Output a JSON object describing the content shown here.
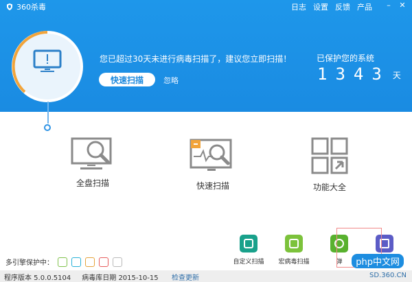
{
  "window": {
    "title": "360杀毒",
    "menu": [
      "日志",
      "设置",
      "反馈",
      "产品"
    ]
  },
  "status": {
    "warning": "您已超过30天未进行病毒扫描了，建议您立即扫描！",
    "quick_scan_button": "快速扫描",
    "ignore_label": "忽略",
    "protected_label": "已保护您的系统",
    "protected_days_digits": [
      "1",
      "3",
      "4",
      "3"
    ],
    "days_unit": "天"
  },
  "features": [
    {
      "label": "全盘扫描",
      "icon": "full-scan-icon"
    },
    {
      "label": "快速扫描",
      "icon": "quick-scan-icon"
    },
    {
      "label": "功能大全",
      "icon": "tools-grid-icon"
    }
  ],
  "bottom": {
    "engines_label": "多引擎保护中：",
    "tools": [
      {
        "label": "自定义扫描",
        "icon": "custom-scan-icon"
      },
      {
        "label": "宏病毒扫描",
        "icon": "macro-scan-icon"
      },
      {
        "label": "弹",
        "icon": "popup-block-icon"
      },
      {
        "label": "",
        "icon": "layers-icon"
      }
    ],
    "watermark": "php中文网"
  },
  "statusbar": {
    "version": "程序版本 5.0.0.5104",
    "virus_db_date": "病毒库日期 2015-10-15",
    "update_link": "检查更新",
    "site": "SD.360.CN"
  },
  "colors": {
    "header_blue": "#1e97ea",
    "accent_orange": "#f2a43a"
  }
}
